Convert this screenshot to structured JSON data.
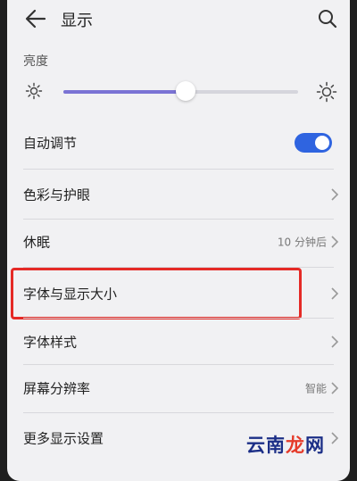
{
  "header": {
    "title": "显示"
  },
  "brightness": {
    "section_label": "亮度",
    "level_percent": 52
  },
  "settings": [
    {
      "label": "自动调节",
      "type": "toggle",
      "on": true
    },
    {
      "label": "色彩与护眼",
      "type": "nav"
    },
    {
      "label": "休眠",
      "type": "nav",
      "value": "10 分钟后"
    },
    {
      "label": "字体与显示大小",
      "type": "nav",
      "highlighted": true
    },
    {
      "label": "字体样式",
      "type": "nav"
    },
    {
      "label": "屏幕分辨率",
      "type": "nav",
      "value": "智能"
    },
    {
      "label": "更多显示设置",
      "type": "nav"
    }
  ],
  "watermark": {
    "part1": "云南",
    "part2": "龙",
    "part3": "网"
  },
  "colors": {
    "accent": "#7a73d4",
    "toggle_on": "#2f64e0",
    "highlight": "#e52a26"
  },
  "icons": [
    "back-arrow-icon",
    "search-icon",
    "sun-small-icon",
    "sun-large-icon",
    "chevron-right-icon"
  ]
}
